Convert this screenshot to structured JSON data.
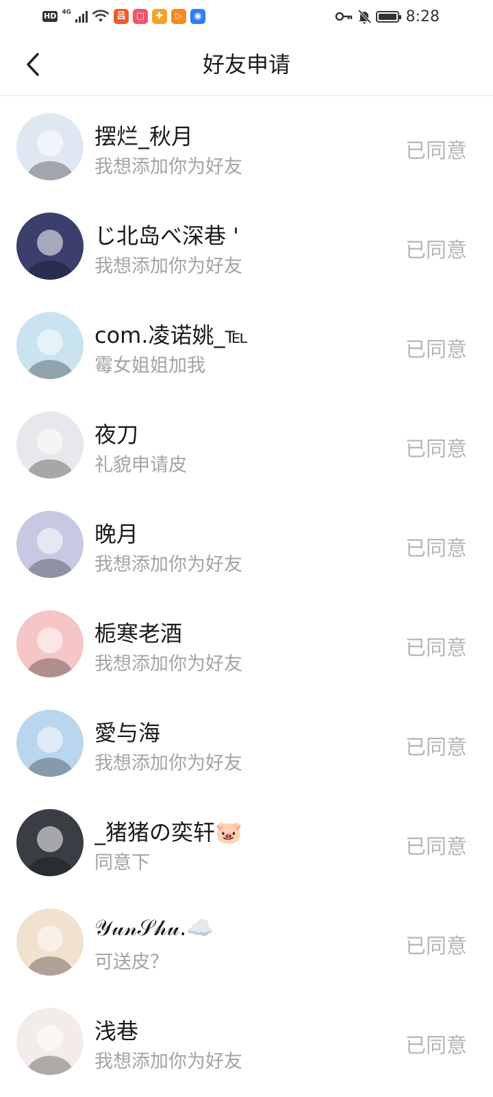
{
  "status_bar": {
    "hd": "HD",
    "network": "4G",
    "time": "8:28"
  },
  "header": {
    "title": "好友申请"
  },
  "requests": [
    {
      "name": "摆烂_秋月",
      "message": "我想添加你为好友",
      "status": "已同意",
      "avatar_color": "#dfe7f2"
    },
    {
      "name": "じ北岛べ深巷 '",
      "message": "我想添加你为好友",
      "status": "已同意",
      "avatar_color": "#3a3f6b"
    },
    {
      "name": "com.凌诺姚_℡",
      "message": "霉女姐姐加我",
      "status": "已同意",
      "avatar_color": "#c9e3f0"
    },
    {
      "name": "夜刀",
      "message": "礼貌申请皮",
      "status": "已同意",
      "avatar_color": "#e8e8ec"
    },
    {
      "name": "晚月",
      "message": "我想添加你为好友",
      "status": "已同意",
      "avatar_color": "#c7c9e3"
    },
    {
      "name": "栀寒老酒",
      "message": "我想添加你为好友",
      "status": "已同意",
      "avatar_color": "#f6c5c5"
    },
    {
      "name": "愛与海",
      "message": "我想添加你为好友",
      "status": "已同意",
      "avatar_color": "#b9d6ee"
    },
    {
      "name": "_猪猪の奕轩🐷",
      "message": "同意下",
      "status": "已同意",
      "avatar_color": "#3a3d44"
    },
    {
      "name": "𝒴𝓊𝓃𝒮𝒽𝓊.☁️",
      "message": "可送皮？",
      "status": "已同意",
      "avatar_color": "#f1e1cf"
    },
    {
      "name": "浅巷",
      "message": "我想添加你为好友",
      "status": "已同意",
      "avatar_color": "#f3ece8"
    }
  ]
}
